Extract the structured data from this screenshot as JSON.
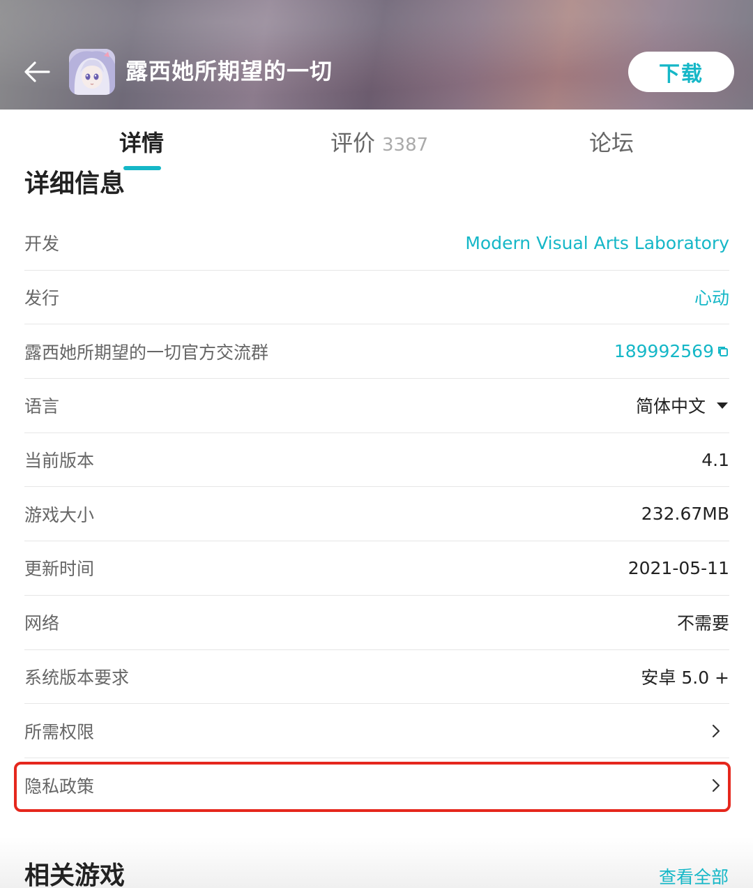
{
  "header": {
    "title": "露西她所期望的一切",
    "download_label": "下载",
    "icons": {
      "back": "arrow-left-icon",
      "app": "app-icon-anime-girl"
    }
  },
  "tabs": [
    {
      "label": "详情",
      "active": true
    },
    {
      "label": "评价",
      "count": "3387",
      "active": false
    },
    {
      "label": "论坛",
      "active": false
    }
  ],
  "section_title": "详细信息",
  "info": [
    {
      "label": "开发",
      "value": "Modern Visual Arts Laboratory",
      "link": true
    },
    {
      "label": "发行",
      "value": "心动",
      "link": true
    },
    {
      "label": "露西她所期望的一切官方交流群",
      "value": "189992569",
      "link": true,
      "icon": "copy-icon"
    },
    {
      "label": "语言",
      "value": "简体中文",
      "icon": "caret-down-icon"
    },
    {
      "label": "当前版本",
      "value": "4.1"
    },
    {
      "label": "游戏大小",
      "value": "232.67MB"
    },
    {
      "label": "更新时间",
      "value": "2021-05-11"
    },
    {
      "label": "网络",
      "value": "不需要"
    },
    {
      "label": "系统版本要求",
      "value": "安卓 5.0 +"
    },
    {
      "label": "所需权限",
      "icon": "chevron-right-icon"
    },
    {
      "label": "隐私政策",
      "icon": "chevron-right-icon",
      "highlighted": true
    }
  ],
  "related": {
    "title": "相关游戏",
    "view_all_label": "查看全部"
  },
  "colors": {
    "accent": "#15b7c7",
    "highlight": "#e5271d"
  }
}
